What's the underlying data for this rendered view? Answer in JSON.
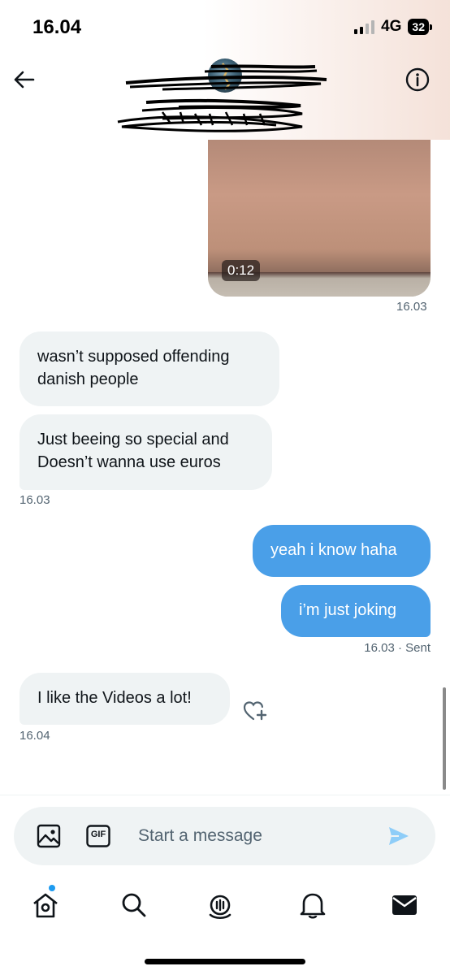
{
  "status_bar": {
    "time": "16.04",
    "network": "4G",
    "battery": "32"
  },
  "header": {
    "back_icon": "arrow-left-icon",
    "info_icon": "info-icon"
  },
  "messages": {
    "video": {
      "duration": "0:12",
      "timestamp": "16.03"
    },
    "incoming_1": {
      "text_line1": "wasn’t supposed offending",
      "text_line2": "danish people"
    },
    "incoming_2": {
      "text_line1": "Just beeing so special and",
      "text_line2": "Doesn’t wanna use euros",
      "timestamp": "16.03"
    },
    "outgoing_1": {
      "text": "yeah i know haha"
    },
    "outgoing_2": {
      "text": "i’m just joking",
      "timestamp": "16.03 · Sent"
    },
    "incoming_3": {
      "text": "I like the Videos a lot!",
      "timestamp": "16.04",
      "reaction_icon": "add-reaction-heart-icon"
    }
  },
  "composer": {
    "placeholder": "Start a message",
    "gif_label": "GIF",
    "media_icon": "image-icon",
    "send_icon": "send-icon"
  },
  "bottom_nav": {
    "items": [
      "home-icon",
      "search-icon",
      "spaces-icon",
      "notifications-icon",
      "messages-icon"
    ]
  },
  "colors": {
    "accent": "#1d9bf0",
    "outgoing_bubble": "#4a9fe8",
    "incoming_bubble": "#eff3f4",
    "muted_text": "#536471"
  }
}
